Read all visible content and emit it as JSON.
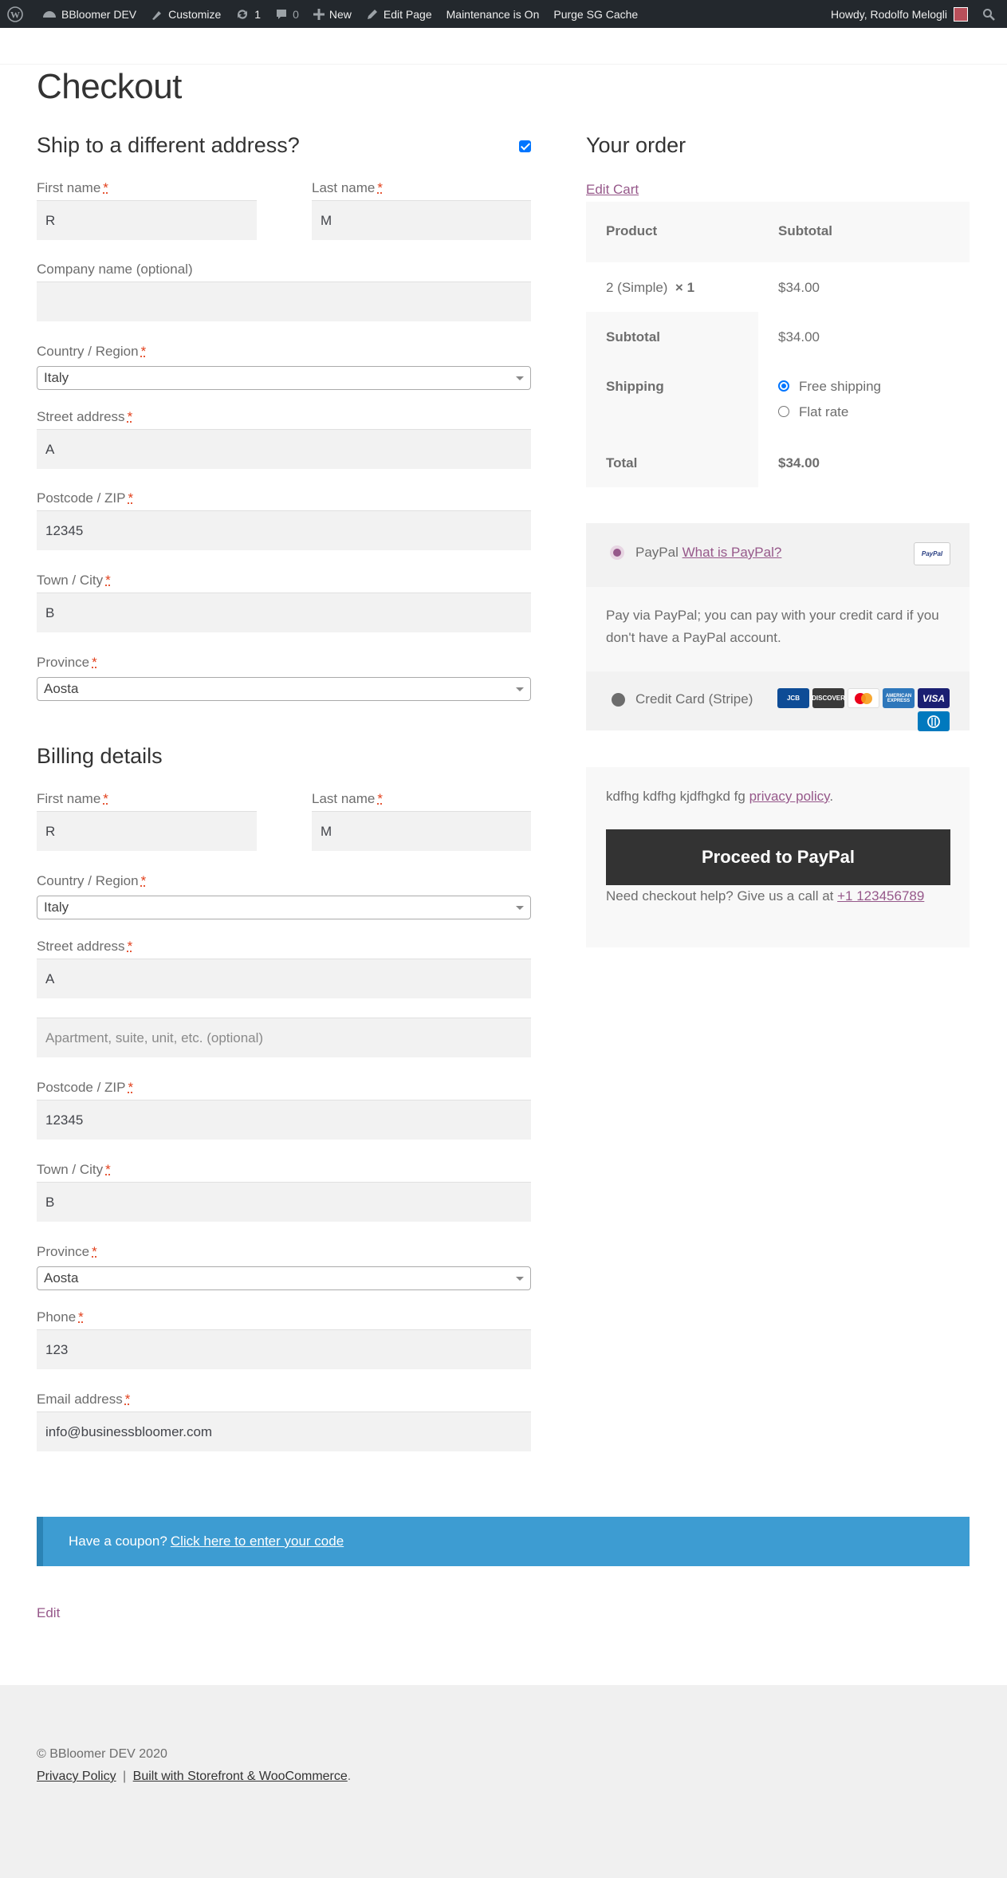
{
  "adminbar": {
    "site_name": "BBloomer DEV",
    "customize": "Customize",
    "updates_count": "1",
    "comments_count": "0",
    "new": "New",
    "edit_page": "Edit Page",
    "maintenance": "Maintenance is On",
    "purge": "Purge SG Cache",
    "howdy": "Howdy, Rodolfo Melogli"
  },
  "page_title": "Checkout",
  "shipping": {
    "title": "Ship to a different address?",
    "first_name_label": "First name",
    "first_name": "R",
    "last_name_label": "Last name",
    "last_name": "M",
    "company_label": "Company name (optional)",
    "company": "",
    "country_label": "Country / Region",
    "country": "Italy",
    "street_label": "Street address",
    "street": "A",
    "postcode_label": "Postcode / ZIP",
    "postcode": "12345",
    "city_label": "Town / City",
    "city": "B",
    "province_label": "Province",
    "province": "Aosta"
  },
  "billing": {
    "title": "Billing details",
    "first_name_label": "First name",
    "first_name": "R",
    "last_name_label": "Last name",
    "last_name": "M",
    "country_label": "Country / Region",
    "country": "Italy",
    "street_label": "Street address",
    "street": "A",
    "street2_placeholder": "Apartment, suite, unit, etc. (optional)",
    "postcode_label": "Postcode / ZIP",
    "postcode": "12345",
    "city_label": "Town / City",
    "city": "B",
    "province_label": "Province",
    "province": "Aosta",
    "phone_label": "Phone",
    "phone": "123",
    "email_label": "Email address",
    "email": "info@businessbloomer.com"
  },
  "required_mark": "*",
  "order": {
    "title": "Your order",
    "edit_cart": "Edit Cart",
    "col_product": "Product",
    "col_subtotal": "Subtotal",
    "item_name": "2 (Simple)",
    "item_qty": "× 1",
    "item_total": "$34.00",
    "subtotal_label": "Subtotal",
    "subtotal": "$34.00",
    "shipping_label": "Shipping",
    "shipping_opt1": "Free shipping",
    "shipping_opt2": "Flat rate",
    "total_label": "Total",
    "total": "$34.00"
  },
  "payment": {
    "paypal_label": "PayPal",
    "paypal_link": "What is PayPal?",
    "paypal_logo": "PayPal",
    "paypal_desc": "Pay via PayPal; you can pay with your credit card if you don't have a PayPal account.",
    "stripe_label": "Credit Card (Stripe)",
    "cards": [
      "JCB",
      "DISCOVER",
      "mastercard",
      "AMERICAN EXPRESS",
      "VISA"
    ],
    "privacy_text": "kdfhg kdfhg kjdfhgkd fg",
    "privacy_link": "privacy policy",
    "place_order": "Proceed to PayPal",
    "help_text": "Need checkout help? Give us a call at",
    "help_phone": "+1 123456789"
  },
  "coupon": {
    "text": "Have a coupon?",
    "link": "Click here to enter your code"
  },
  "edit_link": "Edit",
  "footer": {
    "copyright": "© BBloomer DEV 2020",
    "privacy": "Privacy Policy",
    "separator": "|",
    "built_with": "Built with Storefront & WooCommerce"
  },
  "colors": {
    "adminbar_bg": "#23282d",
    "link": "#96588a",
    "coupon_bg": "#3d9cd2",
    "button_bg": "#333333",
    "required": "#e2401c"
  }
}
